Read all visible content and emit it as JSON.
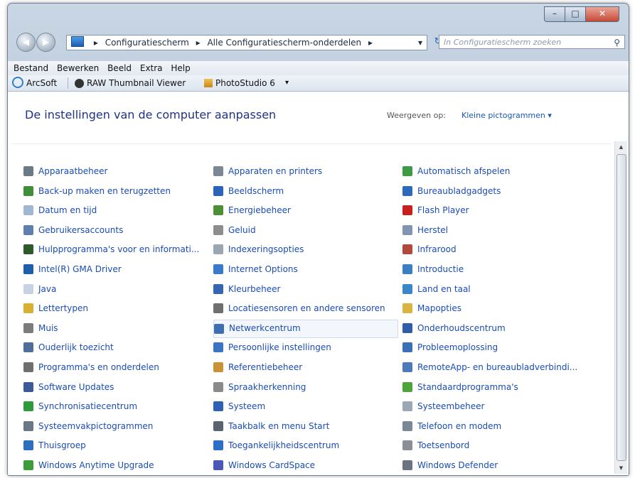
{
  "window": {
    "minimize": "–",
    "maximize": "□",
    "close": "✕"
  },
  "nav": {
    "back_icon": "back-arrow-icon",
    "forward_icon": "forward-arrow-icon"
  },
  "address": {
    "segments": [
      "Configuratiescherm",
      "Alle Configuratiescherm-onderdelen"
    ],
    "separator": "▸",
    "dropdown": "▾",
    "refresh": "↻"
  },
  "search": {
    "placeholder": "In Configuratiescherm zoeken",
    "icon": "⚲"
  },
  "menu": [
    "Bestand",
    "Bewerken",
    "Beeld",
    "Extra",
    "Help"
  ],
  "links": [
    "ArcSoft",
    "RAW Thumbnail Viewer",
    "PhotoStudio 6",
    "▾"
  ],
  "content": {
    "heading": "De instellingen van de computer aanpassen",
    "view_label": "Weergeven op:",
    "view_value": "Kleine pictogrammen ▾"
  },
  "scrollbar": {
    "up": "▲",
    "down": "▼"
  },
  "columns": [
    [
      {
        "label": "Apparaatbeheer",
        "icon": "device-manager-icon",
        "color": "#6a7a86"
      },
      {
        "label": "Back-up maken en terugzetten",
        "icon": "backup-icon",
        "color": "#3f8f3a"
      },
      {
        "label": "Datum en tijd",
        "icon": "date-time-icon",
        "color": "#9fb7d4"
      },
      {
        "label": "Gebruikersaccounts",
        "icon": "user-accounts-icon",
        "color": "#5f7fb0"
      },
      {
        "label": "Hulpprogramma's voor en informati...",
        "icon": "performance-tools-icon",
        "color": "#2d5a2b"
      },
      {
        "label": "Intel(R) GMA Driver",
        "icon": "intel-gma-icon",
        "color": "#1f5ea8"
      },
      {
        "label": "Java",
        "icon": "java-icon",
        "color": "#c7d3e3"
      },
      {
        "label": "Lettertypen",
        "icon": "fonts-icon",
        "color": "#d9b030"
      },
      {
        "label": "Muis",
        "icon": "mouse-icon",
        "color": "#7c7c7c"
      },
      {
        "label": "Ouderlijk toezicht",
        "icon": "parental-controls-icon",
        "color": "#4e6f9a"
      },
      {
        "label": "Programma's en onderdelen",
        "icon": "programs-features-icon",
        "color": "#6f6f6f"
      },
      {
        "label": "Software Updates",
        "icon": "software-updates-icon",
        "color": "#3a5a9a"
      },
      {
        "label": "Synchronisatiecentrum",
        "icon": "sync-center-icon",
        "color": "#2f9a3a"
      },
      {
        "label": "Systeemvakpictogrammen",
        "icon": "notification-icons-icon",
        "color": "#6a7785"
      },
      {
        "label": "Thuisgroep",
        "icon": "homegroup-icon",
        "color": "#2e6fc0"
      },
      {
        "label": "Windows Anytime Upgrade",
        "icon": "anytime-upgrade-icon",
        "color": "#3d9c3a"
      }
    ],
    [
      {
        "label": "Apparaten en printers",
        "icon": "devices-printers-icon",
        "color": "#7a8794"
      },
      {
        "label": "Beeldscherm",
        "icon": "display-icon",
        "color": "#2b63b8"
      },
      {
        "label": "Energiebeheer",
        "icon": "power-options-icon",
        "color": "#4c8f34"
      },
      {
        "label": "Geluid",
        "icon": "sound-icon",
        "color": "#8d8d8d"
      },
      {
        "label": "Indexeringsopties",
        "icon": "indexing-options-icon",
        "color": "#9aa6b2"
      },
      {
        "label": "Internet Options",
        "icon": "internet-options-icon",
        "color": "#3b7ac9"
      },
      {
        "label": "Kleurbeheer",
        "icon": "color-management-icon",
        "color": "#3566b0"
      },
      {
        "label": "Locatiesensoren en andere sensoren",
        "icon": "location-sensors-icon",
        "color": "#6f6f6f"
      },
      {
        "label": "Netwerkcentrum",
        "icon": "network-center-icon",
        "color": "#3e6fb2"
      },
      {
        "label": "Persoonlijke instellingen",
        "icon": "personalization-icon",
        "color": "#3c74c4"
      },
      {
        "label": "Referentiebeheer",
        "icon": "credential-manager-icon",
        "color": "#c9913a"
      },
      {
        "label": "Spraakherkenning",
        "icon": "speech-recognition-icon",
        "color": "#8a8a8a"
      },
      {
        "label": "Systeem",
        "icon": "system-icon",
        "color": "#2f62b2"
      },
      {
        "label": "Taakbalk en menu Start",
        "icon": "taskbar-start-icon",
        "color": "#5a6470"
      },
      {
        "label": "Toegankelijkheidscentrum",
        "icon": "ease-of-access-icon",
        "color": "#2d6ec6"
      },
      {
        "label": "Windows CardSpace",
        "icon": "cardspace-icon",
        "color": "#4b57b8"
      }
    ],
    [
      {
        "label": "Automatisch afspelen",
        "icon": "autoplay-icon",
        "color": "#3f9a45"
      },
      {
        "label": "Bureaubladgadgets",
        "icon": "desktop-gadgets-icon",
        "color": "#2f6ab8"
      },
      {
        "label": "Flash Player",
        "icon": "flash-player-icon",
        "color": "#c8211c"
      },
      {
        "label": "Herstel",
        "icon": "recovery-icon",
        "color": "#7f95b2"
      },
      {
        "label": "Infrarood",
        "icon": "infrared-icon",
        "color": "#b04a3a"
      },
      {
        "label": "Introductie",
        "icon": "getting-started-icon",
        "color": "#3a7fc4"
      },
      {
        "label": "Land en taal",
        "icon": "region-language-icon",
        "color": "#3b86c7"
      },
      {
        "label": "Mapopties",
        "icon": "folder-options-icon",
        "color": "#d9b440"
      },
      {
        "label": "Onderhoudscentrum",
        "icon": "action-center-icon",
        "color": "#2f5da8"
      },
      {
        "label": "Probleemoplossing",
        "icon": "troubleshooting-icon",
        "color": "#3b6fb6"
      },
      {
        "label": "RemoteApp- en bureaubladverbindi...",
        "icon": "remoteapp-icon",
        "color": "#4d7ab8"
      },
      {
        "label": "Standaardprogramma's",
        "icon": "default-programs-icon",
        "color": "#4da43a"
      },
      {
        "label": "Systeembeheer",
        "icon": "administrative-tools-icon",
        "color": "#9aa7b5"
      },
      {
        "label": "Telefoon en modem",
        "icon": "phone-modem-icon",
        "color": "#7b8794"
      },
      {
        "label": "Toetsenbord",
        "icon": "keyboard-icon",
        "color": "#8a8f96"
      },
      {
        "label": "Windows Defender",
        "icon": "windows-defender-icon",
        "color": "#6b7480"
      }
    ]
  ]
}
